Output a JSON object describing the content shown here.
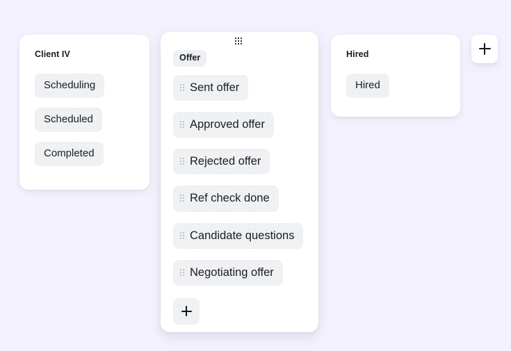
{
  "board": {
    "background_color": "#f2f1fd",
    "card_background": "#ffffff",
    "chip_background": "#f0f1f3",
    "text_color": "#161a23",
    "columns": [
      {
        "id": "client-iv",
        "title": "Client IV",
        "active": false,
        "has_drag_handle": false,
        "chips": [
          {
            "label": "Scheduling",
            "has_handle": false
          },
          {
            "label": "Scheduled",
            "has_handle": false
          },
          {
            "label": "Completed",
            "has_handle": false
          }
        ]
      },
      {
        "id": "offer",
        "title": "Offer",
        "active": true,
        "has_drag_handle": true,
        "drag_handle_icon": "drag-grid-icon",
        "add_chip_icon": "plus-icon",
        "chips": [
          {
            "label": "Sent offer",
            "has_handle": true,
            "handle_icon": "drag-dots-icon"
          },
          {
            "label": "Approved offer",
            "has_handle": true,
            "handle_icon": "drag-dots-icon"
          },
          {
            "label": "Rejected offer",
            "has_handle": true,
            "handle_icon": "drag-dots-icon"
          },
          {
            "label": "Ref check done",
            "has_handle": true,
            "handle_icon": "drag-dots-icon"
          },
          {
            "label": "Candidate questions",
            "has_handle": true,
            "handle_icon": "drag-dots-icon"
          },
          {
            "label": "Negotiating offer",
            "has_handle": true,
            "handle_icon": "drag-dots-icon"
          }
        ]
      },
      {
        "id": "hired",
        "title": "Hired",
        "active": false,
        "has_drag_handle": false,
        "chips": [
          {
            "label": "Hired",
            "has_handle": false
          }
        ]
      }
    ],
    "add_column_button": {
      "icon": "plus-icon",
      "label": ""
    }
  }
}
